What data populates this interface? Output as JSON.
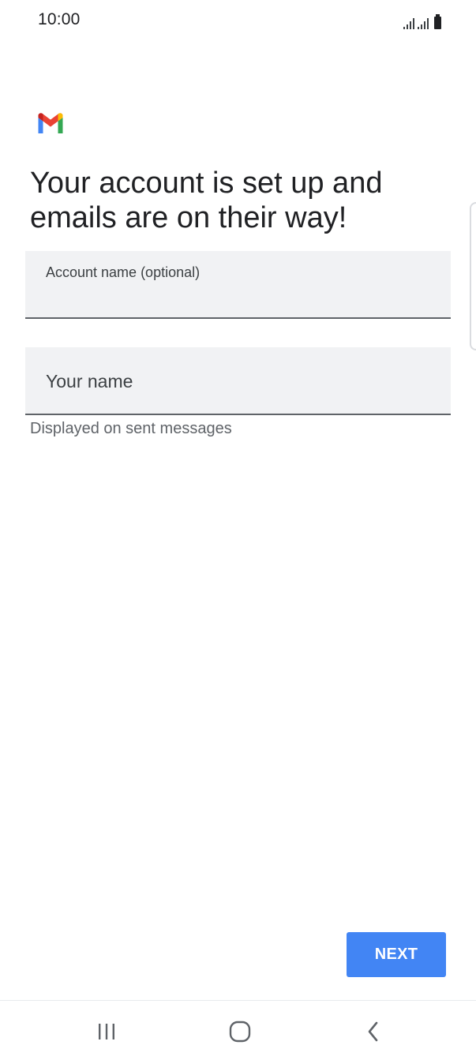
{
  "status_bar": {
    "time": "10:00"
  },
  "app": {
    "logo_icon": "gmail-logo-icon",
    "colors": {
      "red": "#ea4335",
      "blue": "#4285f4",
      "green": "#34a853",
      "yellow": "#fbbc04"
    }
  },
  "main": {
    "title": "Your account is set up and emails are on their way!",
    "account_name_field": {
      "label": "Account name (optional)",
      "value": ""
    },
    "your_name_field": {
      "placeholder": "Your name",
      "value": "",
      "helper": "Displayed on sent messages"
    }
  },
  "actions": {
    "next_label": "NEXT",
    "accent": "#4285f4"
  },
  "nav_bar": {
    "recents_icon": "recents-icon",
    "home_icon": "home-icon",
    "back_icon": "back-icon"
  }
}
